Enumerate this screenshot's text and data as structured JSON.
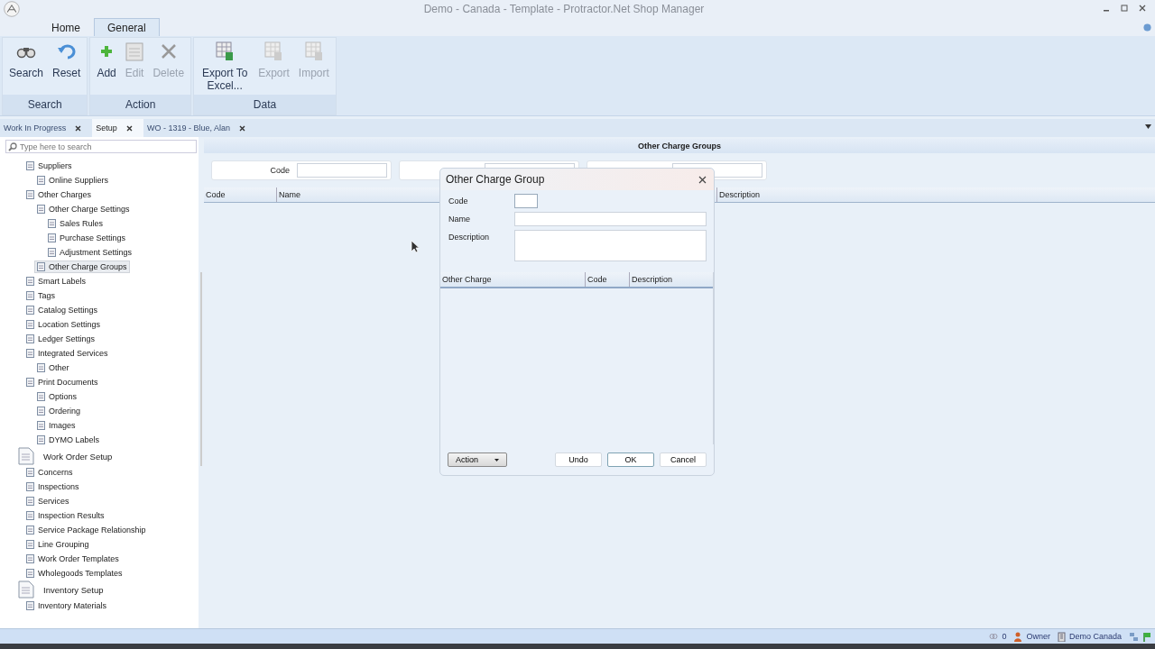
{
  "window": {
    "title": "Demo - Canada - Template - Protractor.Net Shop Manager"
  },
  "ribbon_tabs": [
    {
      "label": "Home",
      "selected": false
    },
    {
      "label": "General",
      "selected": true
    }
  ],
  "ribbon_groups": [
    {
      "label": "Search",
      "buttons": [
        {
          "label": "Search",
          "kind": "binoculars",
          "disabled": false
        },
        {
          "label": "Reset",
          "kind": "undo",
          "disabled": false
        }
      ]
    },
    {
      "label": "Action",
      "buttons": [
        {
          "label": "Add",
          "kind": "plus",
          "disabled": false
        },
        {
          "label": "Edit",
          "kind": "sheet",
          "disabled": true
        },
        {
          "label": "Delete",
          "kind": "cross",
          "disabled": true
        }
      ]
    },
    {
      "label": "Data",
      "buttons": [
        {
          "label": "Export To Excel...",
          "kind": "grid",
          "disabled": false
        },
        {
          "label": "Export",
          "kind": "grid",
          "disabled": true
        },
        {
          "label": "Import",
          "kind": "grid",
          "disabled": true
        }
      ]
    }
  ],
  "document_tabs": [
    {
      "label": "Work In Progress",
      "selected": false
    },
    {
      "label": "Setup",
      "selected": true
    },
    {
      "label": "WO - 1319 - Blue, Alan",
      "selected": false
    }
  ],
  "sidebar": {
    "search": {
      "placeholder": "Type here to search"
    },
    "tree": [
      {
        "label": "Suppliers",
        "kind": "item",
        "selected": false,
        "children": [
          {
            "label": "Online Suppliers",
            "kind": "item",
            "selected": false
          }
        ]
      },
      {
        "label": "Other Charges",
        "kind": "item",
        "selected": false,
        "children": [
          {
            "label": "Other Charge Settings",
            "kind": "item",
            "selected": false,
            "children": [
              {
                "label": "Sales Rules",
                "kind": "item",
                "selected": false
              },
              {
                "label": "Purchase Settings",
                "kind": "item",
                "selected": false
              },
              {
                "label": "Adjustment Settings",
                "kind": "item",
                "selected": false
              }
            ]
          },
          {
            "label": "Other Charge Groups",
            "kind": "item",
            "selected": true
          }
        ]
      },
      {
        "label": "Smart Labels",
        "kind": "item",
        "selected": false
      },
      {
        "label": "Tags",
        "kind": "item",
        "selected": false
      },
      {
        "label": "Catalog Settings",
        "kind": "item",
        "selected": false
      },
      {
        "label": "Location Settings",
        "kind": "item",
        "selected": false
      },
      {
        "label": "Ledger Settings",
        "kind": "item",
        "selected": false
      },
      {
        "label": "Integrated Services",
        "kind": "item",
        "selected": false,
        "children": [
          {
            "label": "Other",
            "kind": "item",
            "selected": false
          }
        ]
      },
      {
        "label": "Print Documents",
        "kind": "item",
        "selected": false,
        "children": [
          {
            "label": "Options",
            "kind": "item",
            "selected": false
          },
          {
            "label": "Ordering",
            "kind": "item",
            "selected": false
          },
          {
            "label": "Images",
            "kind": "item",
            "selected": false
          },
          {
            "label": "DYMO Labels",
            "kind": "item",
            "selected": false
          }
        ]
      },
      {
        "label": "Work Order Setup",
        "kind": "section",
        "selected": false,
        "children": [
          {
            "label": "Concerns",
            "kind": "item",
            "selected": false
          },
          {
            "label": "Inspections",
            "kind": "item",
            "selected": false
          },
          {
            "label": "Services",
            "kind": "item",
            "selected": false
          },
          {
            "label": "Inspection Results",
            "kind": "item",
            "selected": false
          },
          {
            "label": "Service Package Relationship",
            "kind": "item",
            "selected": false
          },
          {
            "label": "Line Grouping",
            "kind": "item",
            "selected": false
          },
          {
            "label": "Work Order Templates",
            "kind": "item",
            "selected": false
          },
          {
            "label": "Wholegoods Templates",
            "kind": "item",
            "selected": false
          }
        ]
      },
      {
        "label": "Inventory Setup",
        "kind": "section",
        "selected": false,
        "children": [
          {
            "label": "Inventory Materials",
            "kind": "item",
            "selected": false
          }
        ]
      }
    ]
  },
  "main": {
    "title": "Other Charge Groups",
    "filter_label": "Code",
    "columns": [
      "Code",
      "Name",
      "Description"
    ]
  },
  "dialog": {
    "title": "Other Charge Group",
    "fields": [
      {
        "label": "Code",
        "kind": "short"
      },
      {
        "label": "Name",
        "kind": "line"
      },
      {
        "label": "Description",
        "kind": "area"
      }
    ],
    "columns": [
      "Other Charge",
      "Code",
      "Description"
    ],
    "buttons": [
      {
        "label": "Action",
        "kind": "menu"
      },
      {
        "label": "Undo",
        "kind": "plain"
      },
      {
        "label": "OK",
        "kind": "default"
      },
      {
        "label": "Cancel",
        "kind": "plain"
      }
    ]
  },
  "status_bar": {
    "count": "0",
    "user": "Owner",
    "location": "Demo Canada"
  }
}
